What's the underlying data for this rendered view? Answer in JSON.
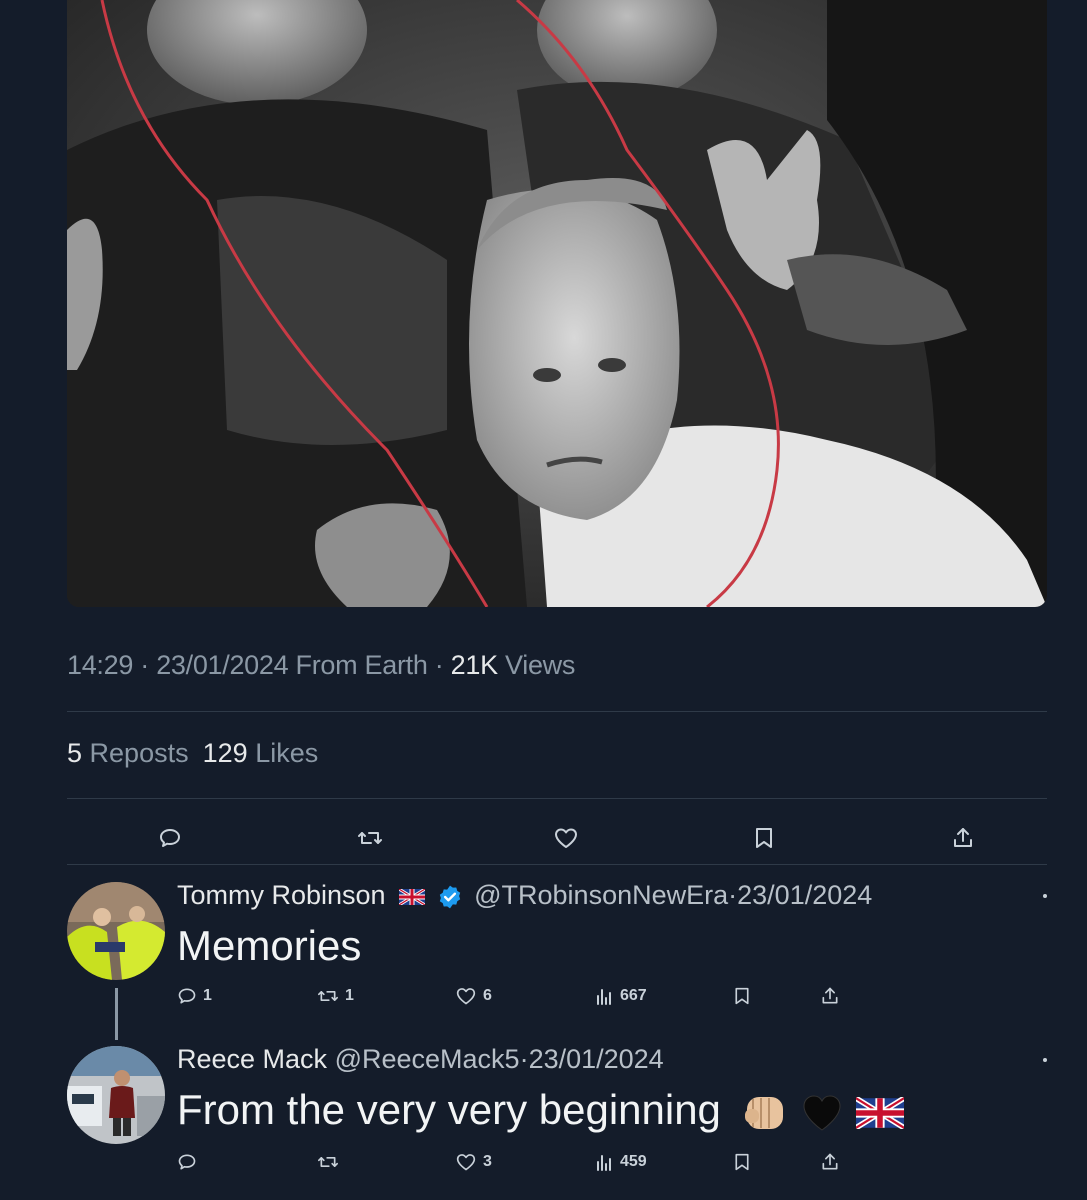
{
  "tweet": {
    "time": "14:29",
    "date": "23/01/2024",
    "source": "From Earth",
    "views_count": "21K",
    "views_label": "Views",
    "reposts_count": "5",
    "reposts_label": "Reposts",
    "likes_count": "129",
    "likes_label": "Likes",
    "sep": "·"
  },
  "replies": [
    {
      "display_name": "Tommy Robinson",
      "handle": "@TRobinsonNewEra",
      "date": "23/01/2024",
      "verified": true,
      "text": "Memories",
      "reply_count": "1",
      "repost_count": "1",
      "like_count": "6",
      "view_count": "667"
    },
    {
      "display_name": "Reece Mack",
      "handle": "@ReeceMack5",
      "date": "23/01/2024",
      "verified": false,
      "text": "From the very very beginning",
      "reply_count": "",
      "repost_count": "",
      "like_count": "3",
      "view_count": "459"
    }
  ],
  "icons": [
    "reply-icon",
    "repost-icon",
    "like-icon",
    "bookmark-icon",
    "share-icon",
    "views-icon",
    "verified-badge-icon",
    "uk-flag-icon",
    "fist-emoji-icon",
    "black-heart-emoji-icon"
  ],
  "colors": {
    "background": "#141c2a",
    "secondary_text": "#8b98a5",
    "verified": "#1d9bf0",
    "annotation_line": "#c83a45"
  }
}
